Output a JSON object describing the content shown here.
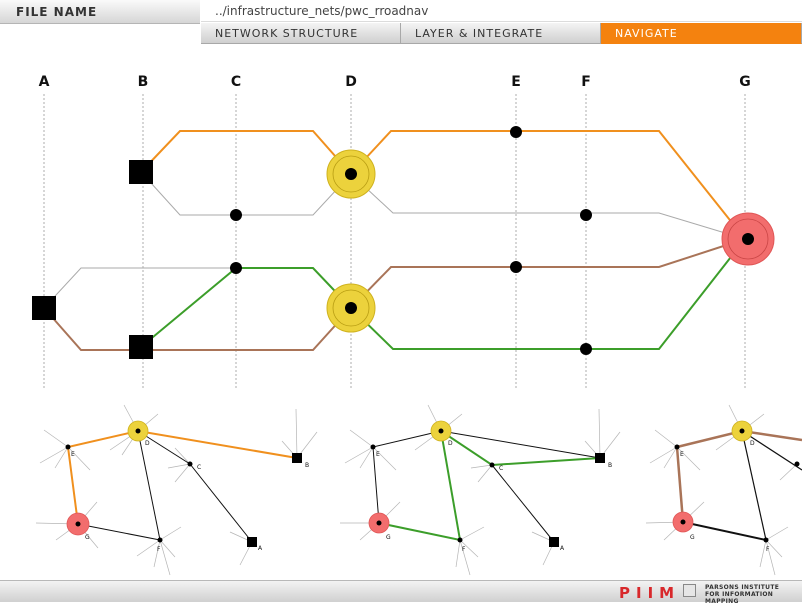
{
  "header": {
    "file_label": "FILE NAME",
    "path": "../infrastructure_nets/pwc_rroadnav"
  },
  "tabs": [
    {
      "label": "NETWORK STRUCTURE",
      "active": false
    },
    {
      "label": "LAYER & INTEGRATE",
      "active": false
    },
    {
      "label": "NAVIGATE",
      "active": true
    }
  ],
  "diagram": {
    "column_labels": [
      "A",
      "B",
      "C",
      "D",
      "E",
      "F",
      "G"
    ]
  },
  "minimaps": [
    {
      "nodes": [
        "E",
        "D",
        "C",
        "B",
        "G",
        "F",
        "A"
      ]
    },
    {
      "nodes": [
        "E",
        "D",
        "C",
        "B",
        "G",
        "F",
        "A"
      ]
    },
    {
      "nodes": [
        "E",
        "D",
        "G",
        "F"
      ]
    }
  ],
  "footer": {
    "brand": "PIIM",
    "org_line1": "PARSONS INSTITUTE",
    "org_line2": "FOR INFORMATION MAPPING"
  },
  "colors": {
    "accent": "#f4820f",
    "orange_route": "#f0901e",
    "green_route": "#3c9e2a",
    "brown_route": "#a97458",
    "node_yellow": "#ecd23c",
    "node_red": "#f26d6d"
  }
}
